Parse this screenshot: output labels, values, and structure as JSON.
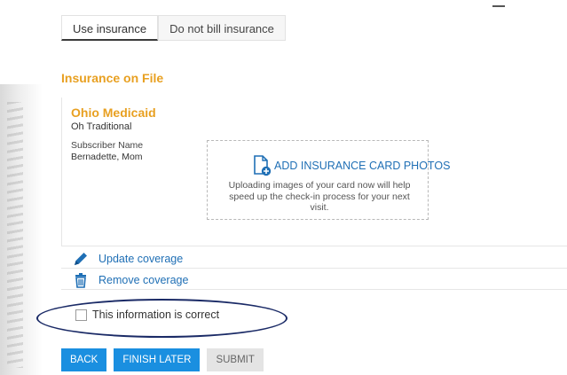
{
  "tabs": [
    {
      "label": "Use insurance"
    },
    {
      "label": "Do not bill insurance"
    }
  ],
  "section_title": "Insurance on File",
  "insurance": {
    "plan_name": "Ohio Medicaid",
    "plan_type": "Oh Traditional",
    "subscriber_label": "Subscriber Name",
    "subscriber_value": "Bernadette, Mom"
  },
  "upload": {
    "icon": "add-document-icon",
    "title": "ADD INSURANCE CARD PHOTOS",
    "description": "Uploading images of your card now will help speed up the check-in process for your next visit."
  },
  "actions": {
    "update_label": "Update coverage",
    "update_icon": "pencil-icon",
    "remove_label": "Remove coverage",
    "remove_icon": "trash-icon"
  },
  "confirm_label": "This information is correct",
  "buttons": {
    "back": "BACK",
    "finish_later": "FINISH LATER",
    "submit": "SUBMIT"
  },
  "colors": {
    "accent_orange": "#e8a021",
    "link_blue": "#1f6fb5",
    "button_blue": "#1a8fe0",
    "annotation_ellipse": "#1a2a66"
  }
}
